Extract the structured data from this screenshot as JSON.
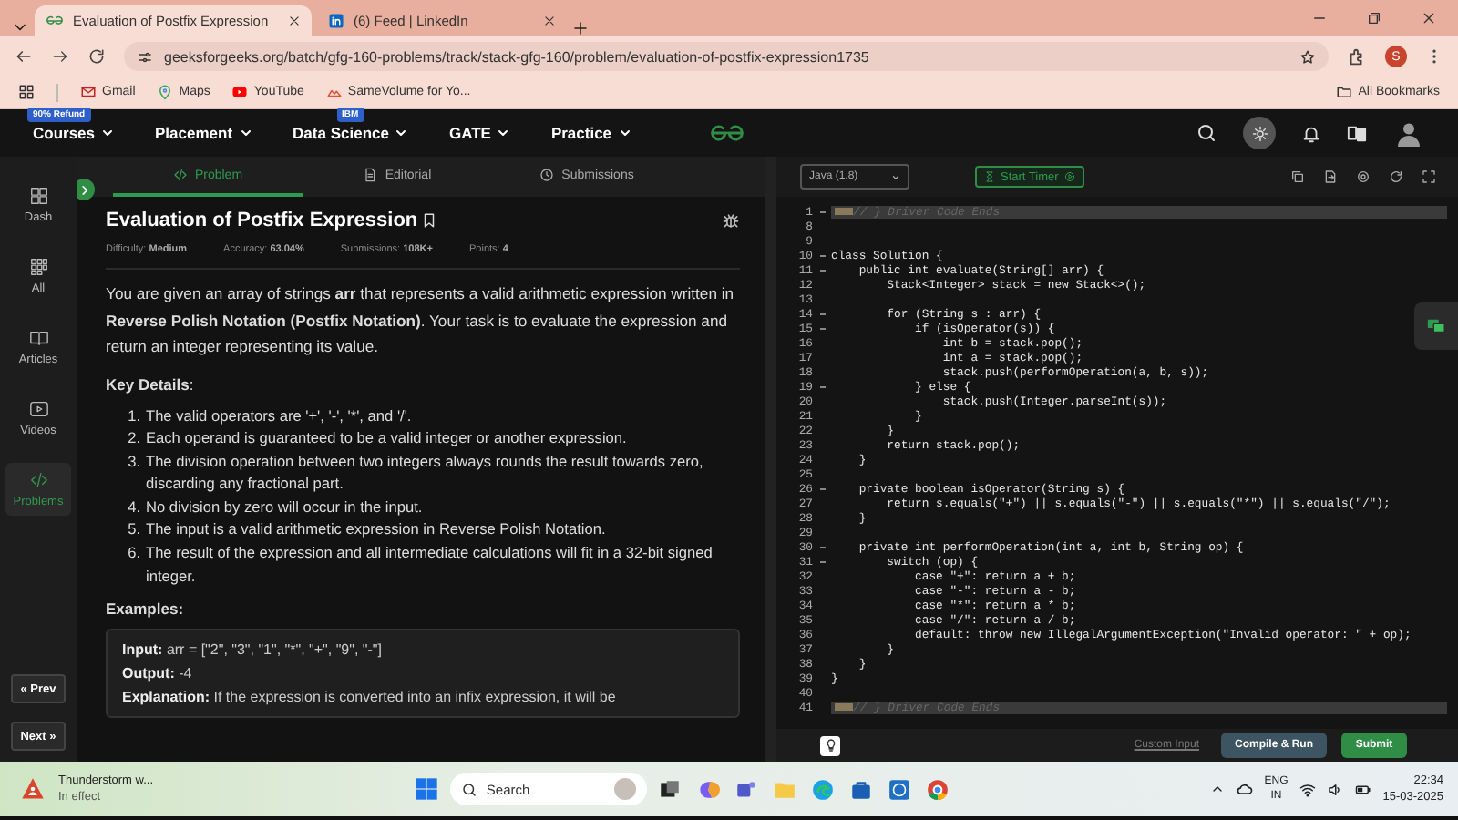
{
  "browser": {
    "tabs": [
      {
        "title": "Evaluation of Postfix Expression",
        "selected": true
      },
      {
        "title": "(6) Feed | LinkedIn",
        "selected": false
      }
    ],
    "url": "geeksforgeeks.org/batch/gfg-160-problems/track/stack-gfg-160/problem/evaluation-of-postfix-expression1735",
    "profile_initial": "S",
    "bookmarks": [
      "Gmail",
      "Maps",
      "YouTube",
      "SameVolume for Yo..."
    ],
    "all_bookmarks": "All Bookmarks"
  },
  "site_nav": {
    "items": [
      {
        "label": "Courses",
        "badge": "90% Refund"
      },
      {
        "label": "Placement"
      },
      {
        "label": "Data Science",
        "badge": "IBM"
      },
      {
        "label": "GATE"
      },
      {
        "label": "Practice"
      }
    ]
  },
  "sidebar": {
    "items": [
      {
        "label": "Dash",
        "selected": false
      },
      {
        "label": "All",
        "selected": false
      },
      {
        "label": "Articles",
        "selected": false
      },
      {
        "label": "Videos",
        "selected": false
      },
      {
        "label": "Problems",
        "selected": true
      }
    ],
    "prev": "« Prev",
    "next": "Next »"
  },
  "problem": {
    "tabs": [
      {
        "label": "Problem",
        "selected": true
      },
      {
        "label": "Editorial",
        "selected": false
      },
      {
        "label": "Submissions",
        "selected": false
      }
    ],
    "title": "Evaluation of Postfix Expression",
    "meta": [
      "Difficulty: **Medium**",
      "Accuracy: **63.04%**",
      "Submissions: **108K+**",
      "Points: **4**"
    ],
    "description": "You are given an array of strings **arr** that represents a valid arithmetic expression written in **Reverse Polish Notation (Postfix Notation)**. Your task is to evaluate the expression and return an integer representing its value.",
    "key_details_heading": "**Key Details**:",
    "key_details": [
      {
        "marker": "1.",
        "text": "The valid operators are '+', '-', '*', and '/'."
      },
      {
        "marker": "2.",
        "text": "Each operand is guaranteed to be a valid integer or another expression."
      },
      {
        "marker": "3.",
        "text": "The division operation between two integers always rounds the result towards zero, discarding any fractional part."
      },
      {
        "marker": "4.",
        "text": "No division by zero will occur in the input."
      },
      {
        "marker": "5.",
        "text": "The input is a valid arithmetic expression in Reverse Polish Notation."
      },
      {
        "marker": "6.",
        "text": "The result of the expression and all intermediate calculations will fit in a 32-bit signed integer."
      }
    ],
    "examples_heading": "Examples:",
    "example": [
      "**Input:** arr = [\"2\", \"3\", \"1\", \"*\", \"+\", \"9\", \"-\"]",
      "**Output:** -4",
      "**Explanation:** If the expression is converted into an infix expression, it will be"
    ]
  },
  "editor": {
    "language": "Java (1.8)",
    "timer": "Start Timer",
    "lines": [
      {
        "number": "1",
        "kind": "folded",
        "foldable": true,
        "text": "// } Driver Code Ends"
      },
      {
        "number": "8",
        "kind": "code",
        "foldable": false
      },
      {
        "number": "9",
        "kind": "code",
        "foldable": false
      },
      {
        "number": "10",
        "kind": "code",
        "foldable": true,
        "text": "class Solution {"
      },
      {
        "number": "11",
        "kind": "code",
        "foldable": true,
        "text": "    public int evaluate(String[] arr) {"
      },
      {
        "number": "12",
        "kind": "code",
        "foldable": false,
        "text": "        Stack<Integer> stack = new Stack<>();"
      },
      {
        "number": "13",
        "kind": "code",
        "foldable": false
      },
      {
        "number": "14",
        "kind": "code",
        "foldable": true,
        "text": "        for (String s : arr) {"
      },
      {
        "number": "15",
        "kind": "code",
        "foldable": true,
        "text": "            if (isOperator(s)) {"
      },
      {
        "number": "16",
        "kind": "code",
        "foldable": false,
        "text": "                int b = stack.pop();"
      },
      {
        "number": "17",
        "kind": "code",
        "foldable": false,
        "text": "                int a = stack.pop();"
      },
      {
        "number": "18",
        "kind": "code",
        "foldable": false,
        "text": "                stack.push(performOperation(a, b, s));"
      },
      {
        "number": "19",
        "kind": "code",
        "foldable": true,
        "text": "            } else {"
      },
      {
        "number": "20",
        "kind": "code",
        "foldable": false,
        "text": "                stack.push(Integer.parseInt(s));"
      },
      {
        "number": "21",
        "kind": "code",
        "foldable": false,
        "text": "            }"
      },
      {
        "number": "22",
        "kind": "code",
        "foldable": false,
        "text": "        }"
      },
      {
        "number": "23",
        "kind": "code",
        "foldable": false,
        "text": "        return stack.pop();"
      },
      {
        "number": "24",
        "kind": "code",
        "foldable": false,
        "text": "    }"
      },
      {
        "number": "25",
        "kind": "code",
        "foldable": false
      },
      {
        "number": "26",
        "kind": "code",
        "foldable": true,
        "text": "    private boolean isOperator(String s) {"
      },
      {
        "number": "27",
        "kind": "code",
        "foldable": false,
        "text": "        return s.equals(\"+\") || s.equals(\"-\") || s.equals(\"*\") || s.equals(\"/\");"
      },
      {
        "number": "28",
        "kind": "code",
        "foldable": false,
        "text": "    }"
      },
      {
        "number": "29",
        "kind": "code",
        "foldable": false
      },
      {
        "number": "30",
        "kind": "code",
        "foldable": true,
        "text": "    private int performOperation(int a, int b, String op) {"
      },
      {
        "number": "31",
        "kind": "code",
        "foldable": true,
        "text": "        switch (op) {"
      },
      {
        "number": "32",
        "kind": "code",
        "foldable": false,
        "text": "            case \"+\": return a + b;"
      },
      {
        "number": "33",
        "kind": "code",
        "foldable": false,
        "text": "            case \"-\": return a - b;"
      },
      {
        "number": "34",
        "kind": "code",
        "foldable": false,
        "text": "            case \"*\": return a * b;"
      },
      {
        "number": "35",
        "kind": "code",
        "foldable": false,
        "text": "            case \"/\": return a / b;"
      },
      {
        "number": "36",
        "kind": "code",
        "foldable": false,
        "text": "            default: throw new IllegalArgumentException(\"Invalid operator: \" + op);"
      },
      {
        "number": "37",
        "kind": "code",
        "foldable": false,
        "text": "        }"
      },
      {
        "number": "38",
        "kind": "code",
        "foldable": false,
        "text": "    }"
      },
      {
        "number": "39",
        "kind": "code",
        "foldable": false,
        "text": "}"
      },
      {
        "number": "40",
        "kind": "code",
        "foldable": false
      },
      {
        "number": "41",
        "kind": "folded",
        "foldable": false,
        "text": "// } Driver Code Ends"
      }
    ],
    "custom_input": "Custom Input",
    "compile": "Compile & Run",
    "submit": "Submit"
  },
  "taskbar": {
    "weather_title": "Thunderstorm w...",
    "weather_subtitle": "In effect",
    "search": "Search",
    "language": "ENG",
    "region": "IN",
    "time": "22:34",
    "date": "15-03-2025"
  }
}
